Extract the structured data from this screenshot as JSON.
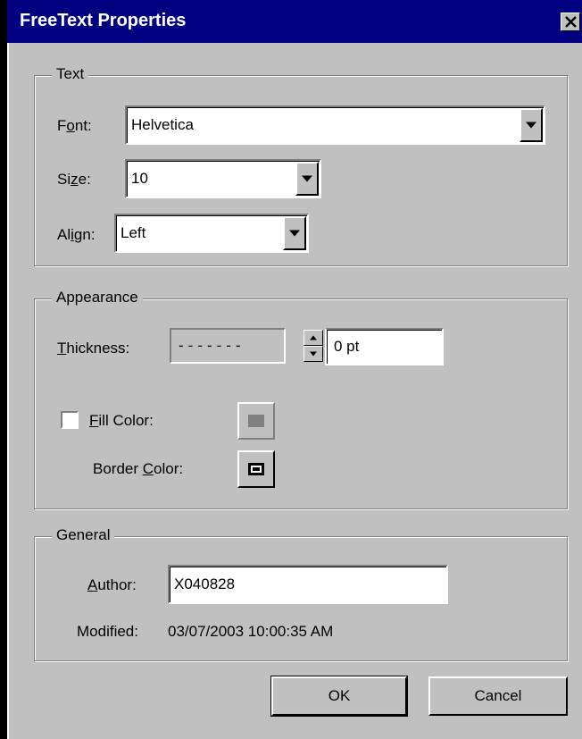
{
  "window": {
    "title": "FreeText Properties",
    "close_symbol": "✕"
  },
  "text_group": {
    "legend": "Text",
    "font": {
      "label_pre": "F",
      "label_ul": "o",
      "label_post": "nt:",
      "value": "Helvetica"
    },
    "size": {
      "label_pre": "Si",
      "label_ul": "z",
      "label_post": "e:",
      "value": "10"
    },
    "align": {
      "label_pre": "Al",
      "label_ul": "i",
      "label_post": "gn:",
      "value": "Left"
    }
  },
  "appearance_group": {
    "legend": "Appearance",
    "thickness": {
      "label_pre": "",
      "label_ul": "T",
      "label_post": "hickness:",
      "line_style": "-------",
      "value": "0 pt"
    },
    "fill_color": {
      "label_pre": "",
      "label_ul": "F",
      "label_post": "ill Color:",
      "checked": false,
      "color": "#808080"
    },
    "border_color": {
      "label_pre": "Border ",
      "label_ul": "C",
      "label_post": "olor:",
      "color": "#000000"
    }
  },
  "general_group": {
    "legend": "General",
    "author": {
      "label_pre": "",
      "label_ul": "A",
      "label_post": "uthor:",
      "value": "X040828"
    },
    "modified": {
      "label": "Modified:",
      "value": "03/07/2003 10:00:35 AM"
    }
  },
  "buttons": {
    "ok": "OK",
    "cancel": "Cancel"
  },
  "colors": {
    "titlebar": "#000080",
    "face": "#c0c0c0",
    "shadow": "#808080",
    "highlight": "#ffffff"
  }
}
